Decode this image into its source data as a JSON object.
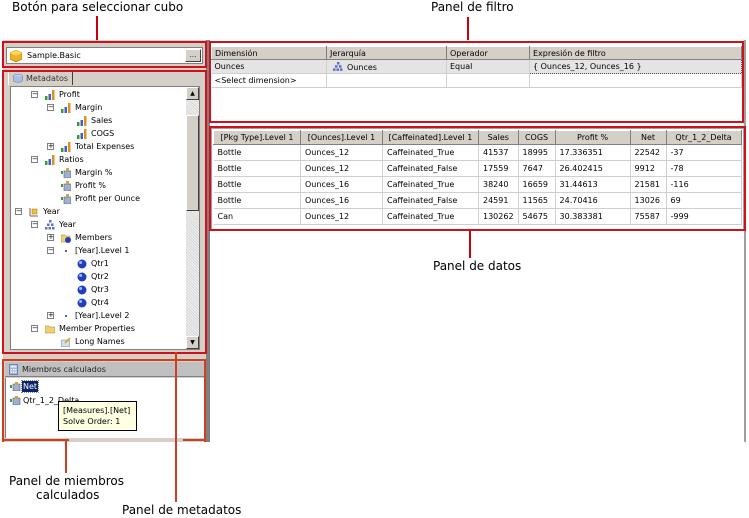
{
  "callouts": {
    "cube_selector": "Botón para seleccionar cubo",
    "filter_panel": "Panel de filtro",
    "data_panel": "Panel de datos",
    "calc_members_panel_line1": "Panel de miembros",
    "calc_members_panel_line2": "calculados",
    "metadata_panel": "Panel de metadatos"
  },
  "cube": {
    "name": "Sample.Basic",
    "browse_label": "..."
  },
  "metadata": {
    "tab_label": "Metadatos",
    "tree": [
      {
        "label": "Profit",
        "icon": "measure-icon",
        "expander": "−"
      },
      {
        "label": "Margin",
        "icon": "measure-icon",
        "expander": "−"
      },
      {
        "label": "Sales",
        "icon": "measure-icon",
        "expander": ""
      },
      {
        "label": "COGS",
        "icon": "measure-icon",
        "expander": ""
      },
      {
        "label": "Total Expenses",
        "icon": "measure-icon",
        "expander": "+"
      },
      {
        "label": "Ratios",
        "icon": "measure-icon",
        "expander": "−"
      },
      {
        "label": "Margin %",
        "icon": "calculated-measure-icon",
        "expander": ""
      },
      {
        "label": "Profit %",
        "icon": "calculated-measure-icon",
        "expander": ""
      },
      {
        "label": "Profit per Ounce",
        "icon": "calculated-measure-icon",
        "expander": ""
      },
      {
        "label": "Year",
        "icon": "dimension-icon",
        "expander": "−"
      },
      {
        "label": "Year",
        "icon": "hierarchy-icon",
        "expander": "−"
      },
      {
        "label": "Members",
        "icon": "members-folder-icon",
        "expander": "+"
      },
      {
        "label": "[Year].Level 1",
        "icon": "level-icon",
        "expander": "−"
      },
      {
        "label": "Qtr1",
        "icon": "member-icon",
        "expander": ""
      },
      {
        "label": "Qtr2",
        "icon": "member-icon",
        "expander": ""
      },
      {
        "label": "Qtr3",
        "icon": "member-icon",
        "expander": ""
      },
      {
        "label": "Qtr4",
        "icon": "member-icon",
        "expander": ""
      },
      {
        "label": "[Year].Level 2",
        "icon": "level-icon",
        "expander": "+"
      },
      {
        "label": "Member Properties",
        "icon": "folder-icon",
        "expander": "−"
      },
      {
        "label": "Long Names",
        "icon": "property-icon",
        "expander": ""
      }
    ]
  },
  "calculated_members": {
    "header": "Miembros calculados",
    "items": [
      {
        "label": "Net",
        "selected": true
      },
      {
        "label": "Qtr_1_2_Delta",
        "selected": false
      }
    ],
    "tooltip_line1": "[Measures].[Net]",
    "tooltip_line2": "Solve Order: 1"
  },
  "filter": {
    "columns": [
      "Dimensión",
      "Jerarquía",
      "Operador",
      "Expresión de filtro"
    ],
    "rows": [
      {
        "dimension": "Ounces",
        "hierarchy": "Ounces",
        "operator": "Equal",
        "expression": "{ Ounces_12, Ounces_16 }"
      },
      {
        "dimension": "<Select dimension>",
        "hierarchy": "",
        "operator": "",
        "expression": ""
      }
    ]
  },
  "data": {
    "columns": [
      "[Pkg Type].Level 1",
      "[Ounces].Level 1",
      "[Caffeinated].Level 1",
      "Sales",
      "COGS",
      "Profit %",
      "Net",
      "Qtr_1_2_Delta"
    ],
    "rows": [
      [
        "Bottle",
        "Ounces_12",
        "Caffeinated_True",
        "41537",
        "18995",
        "17.336351",
        "22542",
        "-37"
      ],
      [
        "Bottle",
        "Ounces_12",
        "Caffeinated_False",
        "17559",
        "7647",
        "26.402415",
        "9912",
        "-78"
      ],
      [
        "Bottle",
        "Ounces_16",
        "Caffeinated_True",
        "38240",
        "16659",
        "31.44613",
        "21581",
        "-116"
      ],
      [
        "Bottle",
        "Ounces_16",
        "Caffeinated_False",
        "24591",
        "11565",
        "24.70416",
        "13026",
        "69"
      ],
      [
        "Can",
        "Ounces_12",
        "Caffeinated_True",
        "130262",
        "54675",
        "30.383381",
        "75587",
        "-999"
      ]
    ]
  }
}
